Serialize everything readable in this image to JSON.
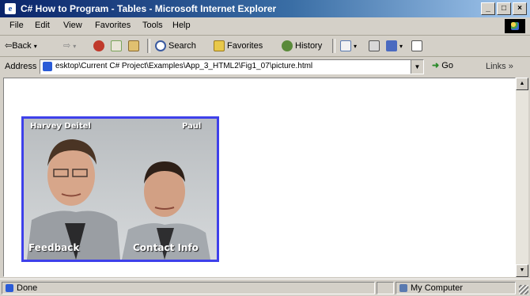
{
  "window": {
    "title": "C# How to Program - Tables - Microsoft Internet Explorer",
    "icon_name": "ie-icon",
    "controls": [
      "_",
      "□",
      "×"
    ]
  },
  "menu": [
    "File",
    "Edit",
    "View",
    "Favorites",
    "Tools",
    "Help"
  ],
  "toolbar": {
    "back": "⇦Back",
    "forward": "⇨",
    "search": "Search",
    "favorites": "Favorites",
    "history": "History"
  },
  "address": {
    "label": "Address",
    "value": "esktop\\Current C# Project\\Examples\\App_3_HTML2\\Fig1_07\\picture.html",
    "go_label": "Go",
    "links_label": "Links »"
  },
  "page": {
    "image_link": {
      "icon_name": "photo",
      "hotspots": {
        "top_left": "Harvey Deitel",
        "top_right": "Paul",
        "bottom_left": "Feedback",
        "bottom_right": "Contact Info"
      },
      "border_color": "#3e40ea"
    }
  },
  "status": {
    "text": "Done",
    "zone": "My Computer"
  },
  "colors": {
    "titlebar_start": "#0a246a",
    "titlebar_end": "#a6caf0",
    "chrome": "#d4d0c8"
  }
}
